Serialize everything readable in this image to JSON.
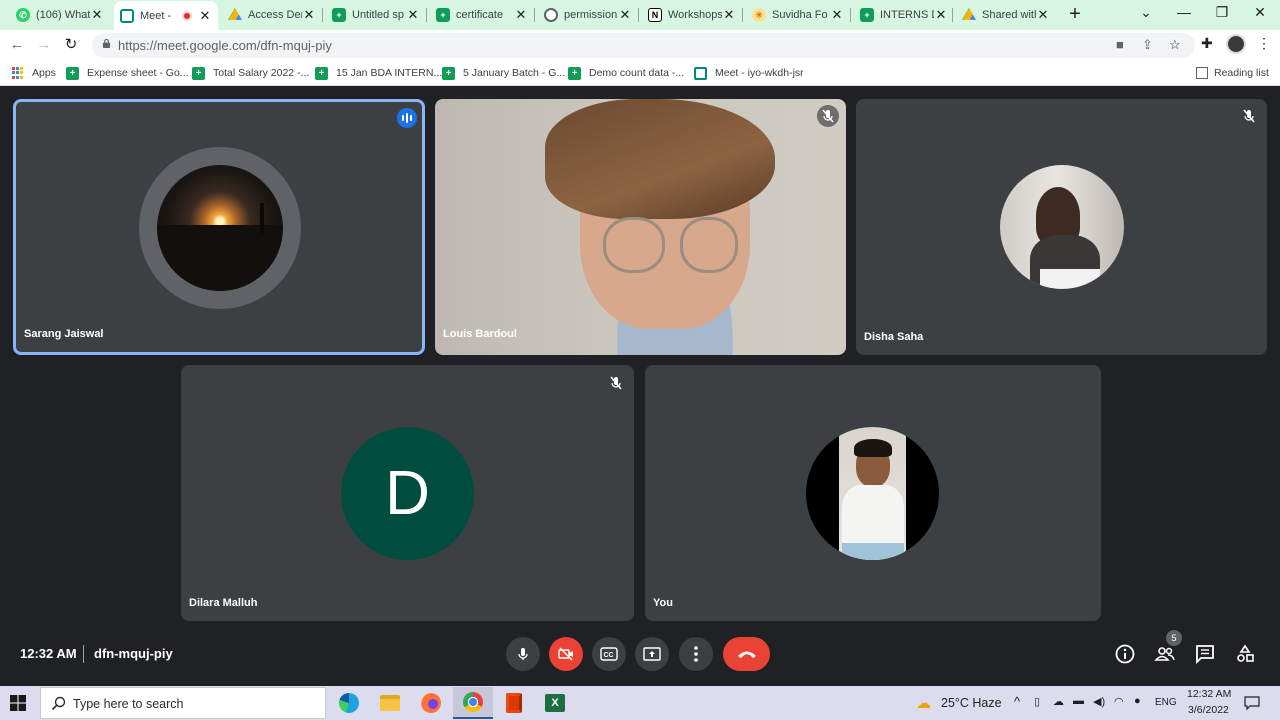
{
  "browser": {
    "tabs": [
      {
        "label": "(106) What",
        "icon": "whatsapp-icon",
        "color": "#25d366"
      },
      {
        "label": "Meet -",
        "icon": "google-meet-icon",
        "color": "#00897b",
        "active": true,
        "recording": true
      },
      {
        "label": "Access Den",
        "icon": "google-drive-icon",
        "color": "#4285f4"
      },
      {
        "label": "Untitled sp",
        "icon": "google-sheets-icon",
        "color": "#0f9d58"
      },
      {
        "label": "certificate",
        "icon": "google-sheets-icon",
        "color": "#0f9d58"
      },
      {
        "label": "permission",
        "icon": "globe-icon",
        "color": "#5f6368"
      },
      {
        "label": "Workshops",
        "icon": "notion-icon",
        "color": "#000000"
      },
      {
        "label": "Suvidha Fo",
        "icon": "sun-icon",
        "color": "#f4b400"
      },
      {
        "label": "INTERNS D",
        "icon": "google-sheets-icon",
        "color": "#0f9d58"
      },
      {
        "label": "Shared with",
        "icon": "google-drive-icon",
        "color": "#4285f4"
      }
    ],
    "url": "https://meet.google.com/dfn-mquj-piy",
    "bookmarks": [
      {
        "label": "Apps"
      },
      {
        "label": "Expense sheet - Go..."
      },
      {
        "label": "Total Salary 2022 -..."
      },
      {
        "label": "15 Jan BDA INTERN..."
      },
      {
        "label": "5 January Batch - G..."
      },
      {
        "label": "Demo count data -..."
      },
      {
        "label": "Meet - iyo-wkdh-jsr"
      }
    ],
    "reading_list": "Reading list"
  },
  "meet": {
    "participants": [
      {
        "name": "Sarang Jaiswal",
        "speaking": true,
        "muted": false
      },
      {
        "name": "Louis Bardoul",
        "muted": true,
        "video": true
      },
      {
        "name": "Disha Saha",
        "muted": true
      },
      {
        "name": "Dilara Malluh",
        "muted": true,
        "initial": "D"
      },
      {
        "name": "You",
        "muted": false
      }
    ],
    "time": "12:32 AM",
    "meeting_code": "dfn-mquj-piy",
    "participant_count": "5",
    "colors": {
      "speaking_border": "#8ab4f8",
      "end_call": "#ea4335",
      "avatar_d": "#004d40",
      "tile_bg": "#3c4043"
    }
  },
  "taskbar": {
    "search_placeholder": "Type here to search",
    "weather": "25°C  Haze",
    "language": "ENG",
    "clock_time": "12:32 AM",
    "clock_date": "3/6/2022"
  }
}
